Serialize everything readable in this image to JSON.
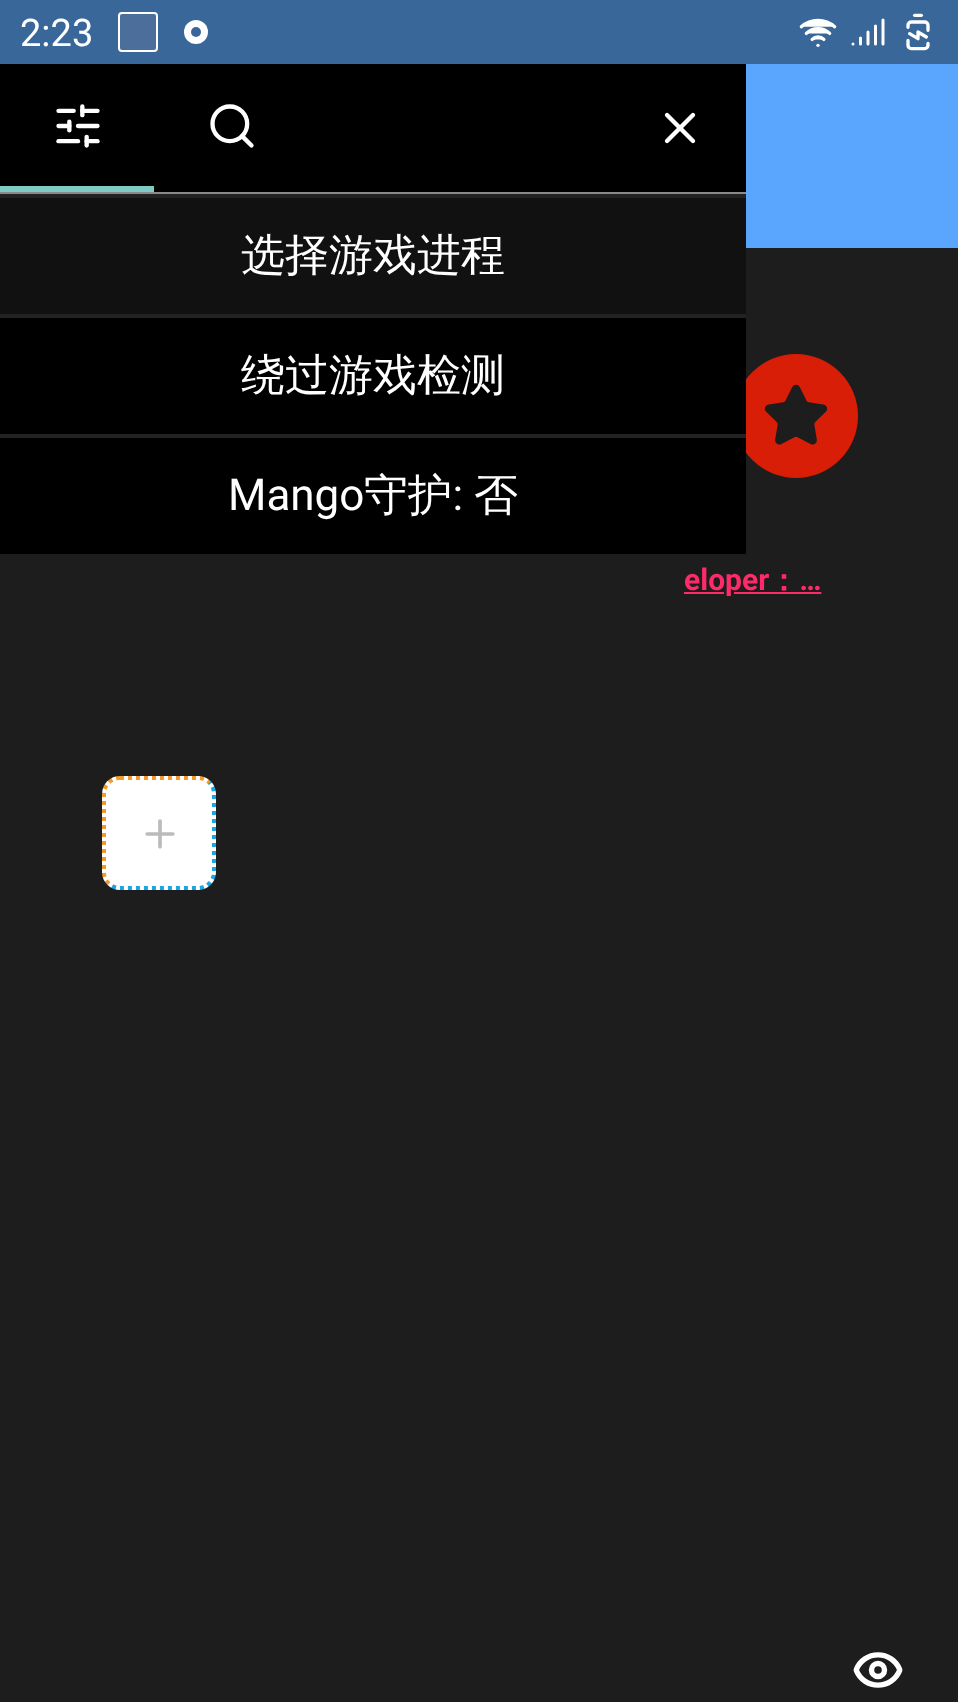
{
  "status_bar": {
    "time": "2:23"
  },
  "panel": {
    "tabs": [
      {
        "kind": "filter",
        "selected": true
      },
      {
        "kind": "search",
        "selected": false
      }
    ],
    "menu": [
      {
        "label": "选择游戏进程",
        "highlighted": true
      },
      {
        "label": "绕过游戏检测",
        "highlighted": false
      },
      {
        "label": "Mango守护: 否",
        "highlighted": false
      }
    ]
  },
  "page": {
    "link": "eloper：…"
  }
}
